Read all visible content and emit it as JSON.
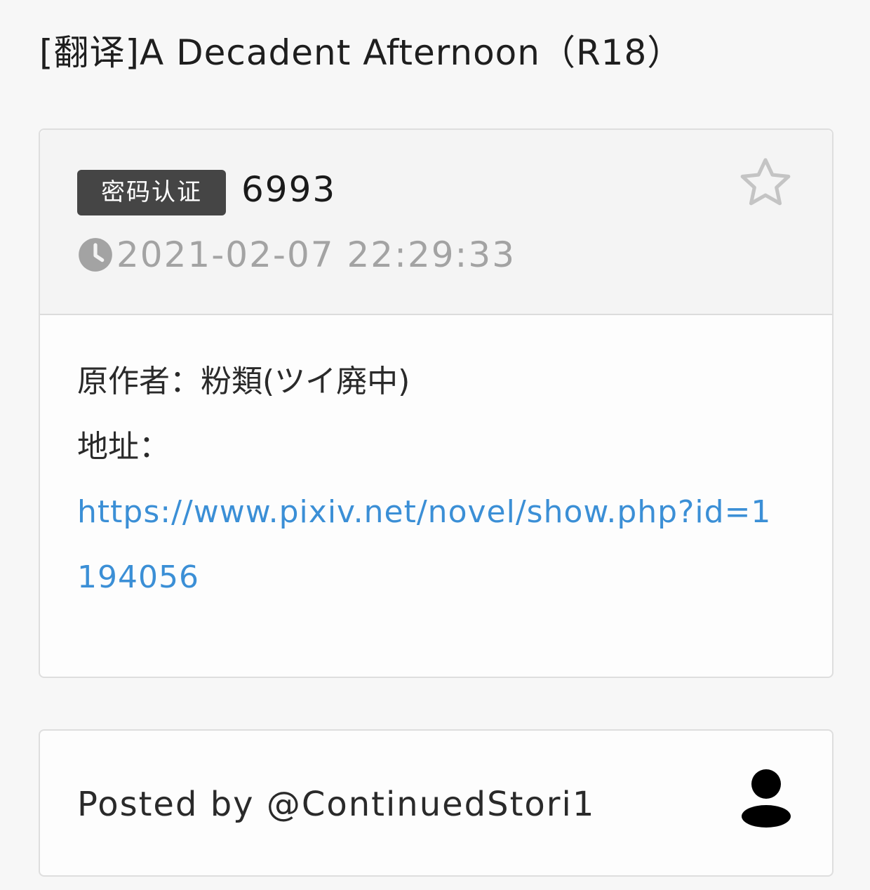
{
  "page": {
    "title": "[翻译]A Decadent Afternoon（R18）"
  },
  "post": {
    "badge_label": "密码认证",
    "password": "6993",
    "timestamp": "2021-02-07 22:29:33",
    "author_line": "原作者：粉類(ツイ廃中)",
    "address_label": "地址：",
    "link": "https://www.pixiv.net/novel/show.php?id=1194056"
  },
  "footer": {
    "posted_by": "Posted by @ContinuedStori1"
  },
  "icons": {
    "favorite": "star-outline-icon",
    "time": "clock-icon",
    "user": "user-icon"
  },
  "colors": {
    "badge_bg": "#454545",
    "link": "#3b8fd6",
    "muted": "#a3a3a3"
  }
}
